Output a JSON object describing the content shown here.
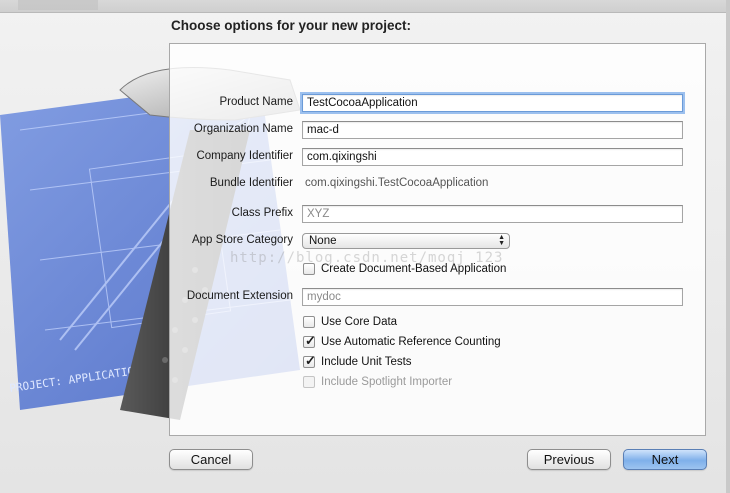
{
  "window": {
    "heading": "Choose options for your new project:"
  },
  "form": {
    "product_name": {
      "label": "Product Name",
      "value": "TestCocoaApplication"
    },
    "organization_name": {
      "label": "Organization Name",
      "value": "mac-d"
    },
    "company_identifier": {
      "label": "Company Identifier",
      "value": "com.qixingshi"
    },
    "bundle_identifier": {
      "label": "Bundle Identifier",
      "value": "com.qixingshi.TestCocoaApplication"
    },
    "class_prefix": {
      "label": "Class Prefix",
      "placeholder": "XYZ"
    },
    "app_store_category": {
      "label": "App Store Category",
      "selected": "None"
    },
    "document_based": {
      "label": "Create Document-Based Application",
      "checked": false
    },
    "document_extension": {
      "label": "Document Extension",
      "placeholder": "mydoc"
    },
    "use_core_data": {
      "label": "Use Core Data",
      "checked": false
    },
    "use_arc": {
      "label": "Use Automatic Reference Counting",
      "checked": true
    },
    "include_unit_tests": {
      "label": "Include Unit Tests",
      "checked": true
    },
    "include_spotlight_importer": {
      "label": "Include Spotlight Importer",
      "checked": false,
      "enabled": false
    }
  },
  "watermark": "http://blog.csdn.net/moqj_123",
  "buttons": {
    "cancel": "Cancel",
    "previous": "Previous",
    "next": "Next"
  },
  "art": {
    "blueprint_text": "PROJECT: APPLICATION.APP"
  },
  "colors": {
    "accent": "#7fb0ea",
    "focus_ring": "#9cc0ee",
    "blueprint": "#4a6fd0"
  }
}
